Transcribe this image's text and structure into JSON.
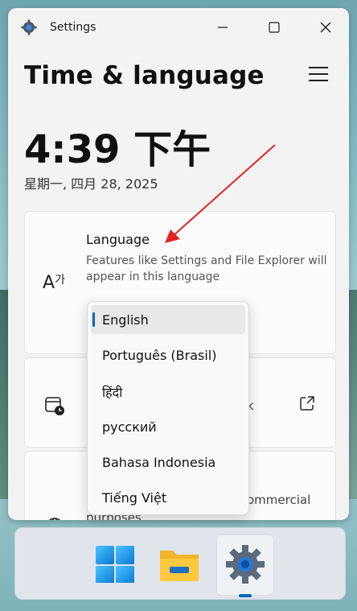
{
  "window": {
    "title": "Settings"
  },
  "page": {
    "title": "Time & language",
    "time": "4:39 下午",
    "date": "星期一, 四月 28, 2025"
  },
  "language_card": {
    "title": "Language",
    "description": "Features like Settings and File Explorer will appear in this language"
  },
  "card2": {
    "partial_text": "k"
  },
  "card3": {
    "partial_text": "ommercial",
    "partial_text_2": "purposes"
  },
  "language_dropdown": {
    "selected": "English",
    "options": [
      "English",
      "Português (Brasil)",
      "हिंदी",
      "русский",
      "Bahasa Indonesia",
      "Tiếng Việt"
    ]
  },
  "taskbar": {
    "items": [
      "start-button",
      "file-explorer",
      "settings"
    ]
  },
  "colors": {
    "accent": "#0067c0",
    "arrow": "#e02424"
  }
}
